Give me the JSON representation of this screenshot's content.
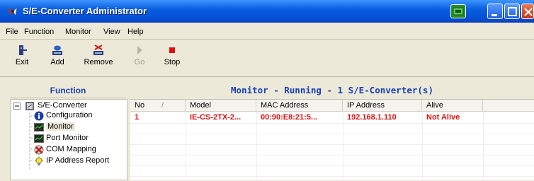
{
  "window": {
    "title": "S/E-Converter Administrator",
    "titlebar_color": "#0550d6"
  },
  "menu": {
    "items": [
      "File",
      "Function",
      "Monitor",
      "View",
      "Help"
    ]
  },
  "toolbar": {
    "buttons": [
      {
        "label": "Exit",
        "icon": "exit-icon",
        "enabled": true
      },
      {
        "label": "Add",
        "icon": "add-icon",
        "enabled": true
      },
      {
        "label": "Remove",
        "icon": "remove-icon",
        "enabled": true
      },
      {
        "label": "Go",
        "icon": "go-icon",
        "enabled": false
      },
      {
        "label": "Stop",
        "icon": "stop-icon",
        "enabled": true
      }
    ]
  },
  "left_panel": {
    "header": "Function",
    "tree": {
      "root": "S/E-Converter",
      "children": [
        {
          "label": "Configuration",
          "icon": "info-icon"
        },
        {
          "label": "Monitor",
          "icon": "monitor-icon"
        },
        {
          "label": "Port Monitor",
          "icon": "monitor-icon"
        },
        {
          "label": "COM Mapping",
          "icon": "com-mapping-icon"
        },
        {
          "label": "IP Address Report",
          "icon": "lightbulb-icon"
        }
      ]
    }
  },
  "right_panel": {
    "header": "Monitor - Running - 1 S/E-Converter(s)",
    "columns": [
      "No",
      "Model",
      "MAC Address",
      "IP Address",
      "Alive"
    ],
    "sort_indicator": "/",
    "rows": [
      {
        "no": "1",
        "model": "IE-CS-2TX-2...",
        "mac": "00:90:E8:21:5...",
        "ip": "192.168.1.110",
        "alive": "Not Alive"
      }
    ],
    "row_color": "#e01010"
  }
}
